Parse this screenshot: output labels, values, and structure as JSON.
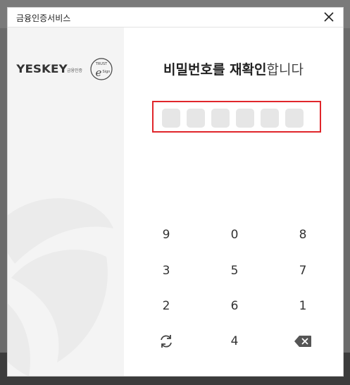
{
  "dialog": {
    "title": "금융인증서비스"
  },
  "brand": {
    "logo_text": "YESKEY",
    "logo_sub": "금융인증",
    "emblem_top": "TRUST",
    "emblem_bottom": "Sign"
  },
  "prompt": {
    "bold_part": "비밀번호를 재확인",
    "light_part": "합니다"
  },
  "pin": {
    "length": 6,
    "filled": 0
  },
  "keypad": {
    "rows": [
      [
        "9",
        "0",
        "8"
      ],
      [
        "3",
        "5",
        "7"
      ],
      [
        "2",
        "6",
        "1"
      ]
    ],
    "last_row": {
      "left": "refresh-icon",
      "center": "4",
      "right": "backspace-icon"
    }
  },
  "colors": {
    "highlight_border": "#e0262b",
    "pin_box": "#e6e6e6",
    "left_panel": "#f4f4f4"
  }
}
